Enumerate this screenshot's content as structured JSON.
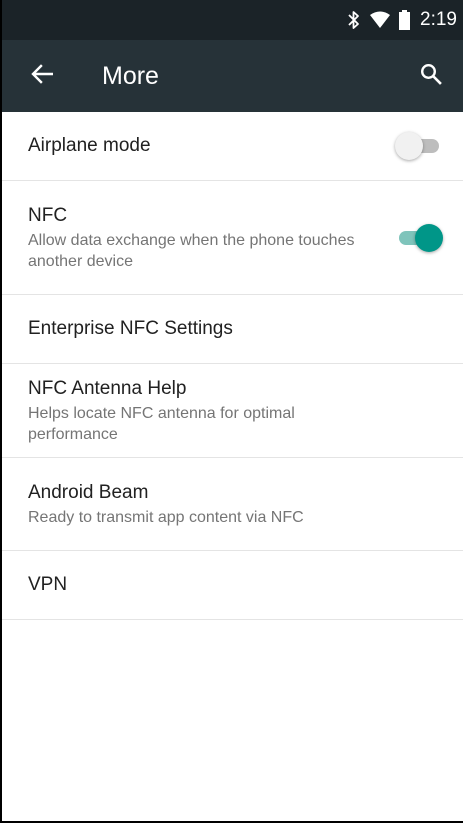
{
  "status_bar": {
    "time": "2:19",
    "icons": [
      "bluetooth-icon",
      "wifi-icon",
      "battery-icon"
    ]
  },
  "app_bar": {
    "title": "More",
    "back_icon": "arrow-left-icon",
    "search_icon": "search-icon"
  },
  "settings": {
    "items": [
      {
        "title": "Airplane mode",
        "subtitle": "",
        "toggle": "off"
      },
      {
        "title": "NFC",
        "subtitle": "Allow data exchange when the phone touches another device",
        "toggle": "on"
      },
      {
        "title": "Enterprise NFC Settings",
        "subtitle": ""
      },
      {
        "title": "NFC Antenna Help",
        "subtitle": "Helps locate NFC antenna for optimal performance"
      },
      {
        "title": "Android Beam",
        "subtitle": "Ready to transmit app content via NFC"
      },
      {
        "title": "VPN",
        "subtitle": ""
      }
    ]
  },
  "colors": {
    "status_bar": "#1b2328",
    "app_bar": "#263238",
    "accent": "#009688"
  }
}
